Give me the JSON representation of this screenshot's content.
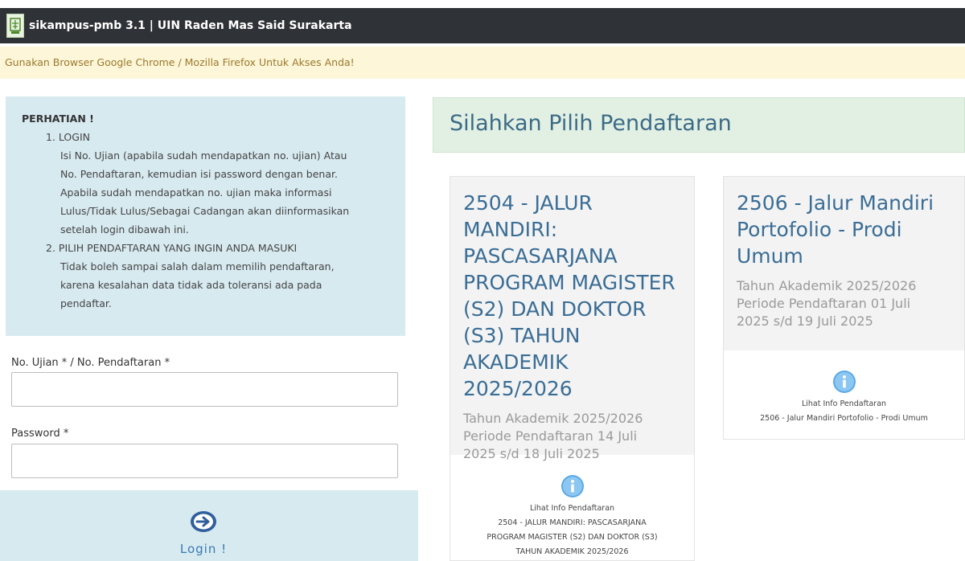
{
  "header": {
    "title": "sikampus-pmb 3.1 | UIN Raden Mas Said Surakarta",
    "logo_icon": "campus-logo-icon"
  },
  "notice": {
    "text": "Gunakan Browser Google Chrome / Mozilla Firefox Untuk Akses Anda!"
  },
  "attention": {
    "title": "PERHATIAN !",
    "item1_heading": "1. LOGIN",
    "item1_lines": [
      "Isi No. Ujian (apabila sudah mendapatkan no. ujian) Atau",
      "No. Pendaftaran, kemudian isi password dengan benar.",
      "Apabila sudah mendapatkan no. ujian maka informasi",
      "Lulus/Tidak Lulus/Sebagai Cadangan akan diinformasikan",
      "setelah login dibawah ini."
    ],
    "item2_heading": "2. PILIH PENDAFTARAN YANG INGIN ANDA MASUKI",
    "item2_lines": [
      "Tidak boleh sampai salah dalam memilih pendaftaran,",
      "karena kesalahan data tidak ada toleransi ada pada",
      "pendaftar."
    ]
  },
  "form": {
    "id_label": "No. Ujian * / No. Pendaftaran *",
    "id_value": "",
    "password_label": "Password *",
    "password_value": "",
    "login_label": "Login !"
  },
  "registration": {
    "heading": "Silahkan Pilih Pendaftaran",
    "cards": [
      {
        "title_lines": [
          "2504 - JALUR",
          "MANDIRI:",
          "PASCASARJANA",
          "PROGRAM MAGISTER",
          "(S2) DAN DOKTOR",
          "(S3) TAHUN",
          "AKADEMIK 2025/2026"
        ],
        "meta_lines": [
          "Tahun Akademik 2025/2026",
          "Periode Pendaftaran 14 Juli",
          "2025 s/d 18 Juli 2025"
        ],
        "link_label": "Lihat Info Pendaftaran",
        "foot_lines": [
          "2504 - JALUR MANDIRI: PASCASARJANA",
          "PROGRAM MAGISTER (S2) DAN DOKTOR (S3)",
          "TAHUN AKADEMIK 2025/2026"
        ]
      },
      {
        "title_lines": [
          "2506 - Jalur Mandiri",
          "Portofolio - Prodi",
          "Umum"
        ],
        "meta_lines": [
          "Tahun Akademik 2025/2026",
          "Periode Pendaftaran 01 Juli",
          "2025 s/d 19 Juli 2025"
        ],
        "link_label": "Lihat Info Pendaftaran",
        "foot_lines": [
          "2506 - Jalur Mandiri Portofolio - Prodi Umum"
        ]
      }
    ]
  },
  "colors": {
    "navbar": "#2f3236",
    "notice_bg": "#fdf6d8",
    "notice_text": "#9b7a2e",
    "info_bg": "#d7eaf0",
    "heading_bg": "#e2f0e4",
    "card_title": "#3a6d95"
  }
}
